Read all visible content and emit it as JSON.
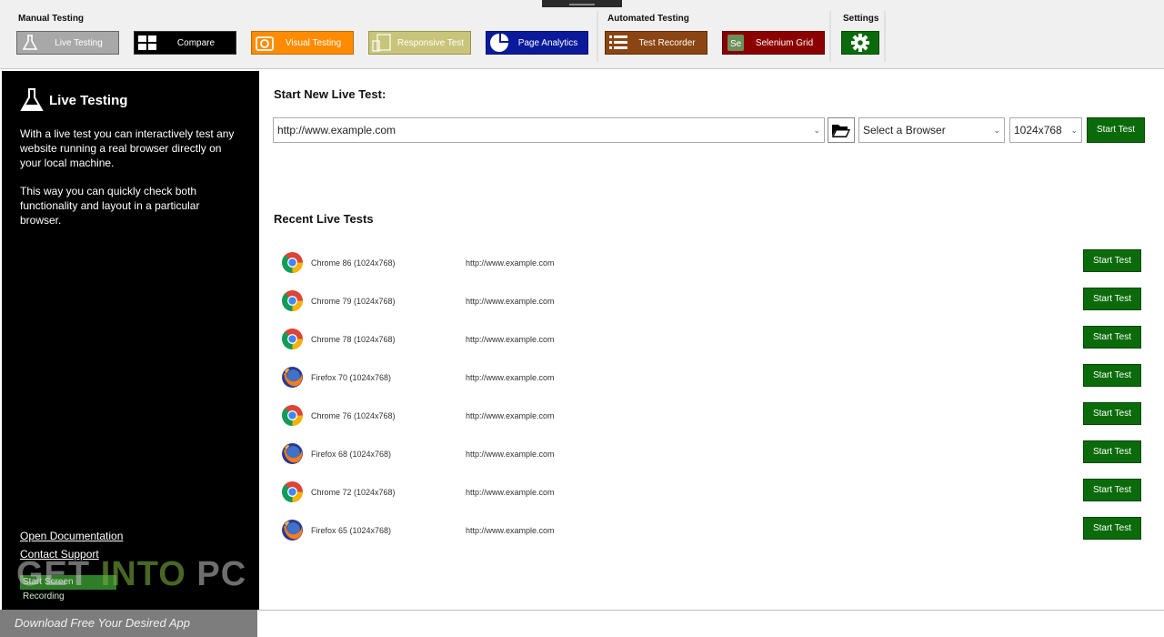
{
  "ribbon": {
    "groups": {
      "manual": "Manual Testing",
      "automated": "Automated Testing",
      "settings": "Settings"
    },
    "buttons": {
      "live_testing": "Live Testing",
      "compare": "Compare",
      "visual_testing": "Visual Testing",
      "responsive_test": "Responsive Test",
      "page_analytics": "Page Analytics",
      "test_recorder": "Test Recorder",
      "selenium_grid": "Selenium Grid"
    },
    "colors": {
      "live_testing": "#a8a8a8",
      "compare": "#000000",
      "visual_testing": "#ff8c00",
      "responsive_test": "#c8c47a",
      "page_analytics": "#0a1a9a",
      "test_recorder": "#8b4513",
      "selenium_grid": "#8b0000",
      "settings": "#0b6b0b"
    }
  },
  "sidebar": {
    "title": "Live Testing",
    "para1": "With a live test you can interactively test any website running a real browser directly on your local machine.",
    "para2": "This way you can quickly check both functionality and layout in a particular browser.",
    "open_docs": "Open Documentation",
    "contact_support": "Contact Support",
    "start_recording": "Start Screen Recording"
  },
  "watermark": {
    "get": "GET",
    "into": "INTO",
    "pc": "PC",
    "tagline": "Download Free Your Desired App"
  },
  "main": {
    "new_test_title": "Start New Live Test:",
    "url_value": "http://www.example.com",
    "browser_placeholder": "Select a Browser",
    "resolution": "1024x768",
    "start_label": "Start Test",
    "recent_title": "Recent Live Tests",
    "recent": [
      {
        "browser": "Chrome 86 (1024x768)",
        "url": "http://www.example.com",
        "icon": "chrome-icon",
        "button": "Start Test"
      },
      {
        "browser": "Chrome 79 (1024x768)",
        "url": "http://www.example.com",
        "icon": "chrome-icon",
        "button": "Start Test"
      },
      {
        "browser": "Chrome 78 (1024x768)",
        "url": "http://www.example.com",
        "icon": "chrome-icon",
        "button": "Start Test"
      },
      {
        "browser": "Firefox 70 (1024x768)",
        "url": "http://www.example.com",
        "icon": "firefox-icon",
        "button": "Start Test"
      },
      {
        "browser": "Chrome 76 (1024x768)",
        "url": "http://www.example.com",
        "icon": "chrome-icon",
        "button": "Start Test"
      },
      {
        "browser": "Firefox 68 (1024x768)",
        "url": "http://www.example.com",
        "icon": "firefox-icon",
        "button": "Start Test"
      },
      {
        "browser": "Chrome 72 (1024x768)",
        "url": "http://www.example.com",
        "icon": "chrome-icon",
        "button": "Start Test"
      },
      {
        "browser": "Firefox 65 (1024x768)",
        "url": "http://www.example.com",
        "icon": "firefox-icon",
        "button": "Start Test"
      }
    ]
  }
}
